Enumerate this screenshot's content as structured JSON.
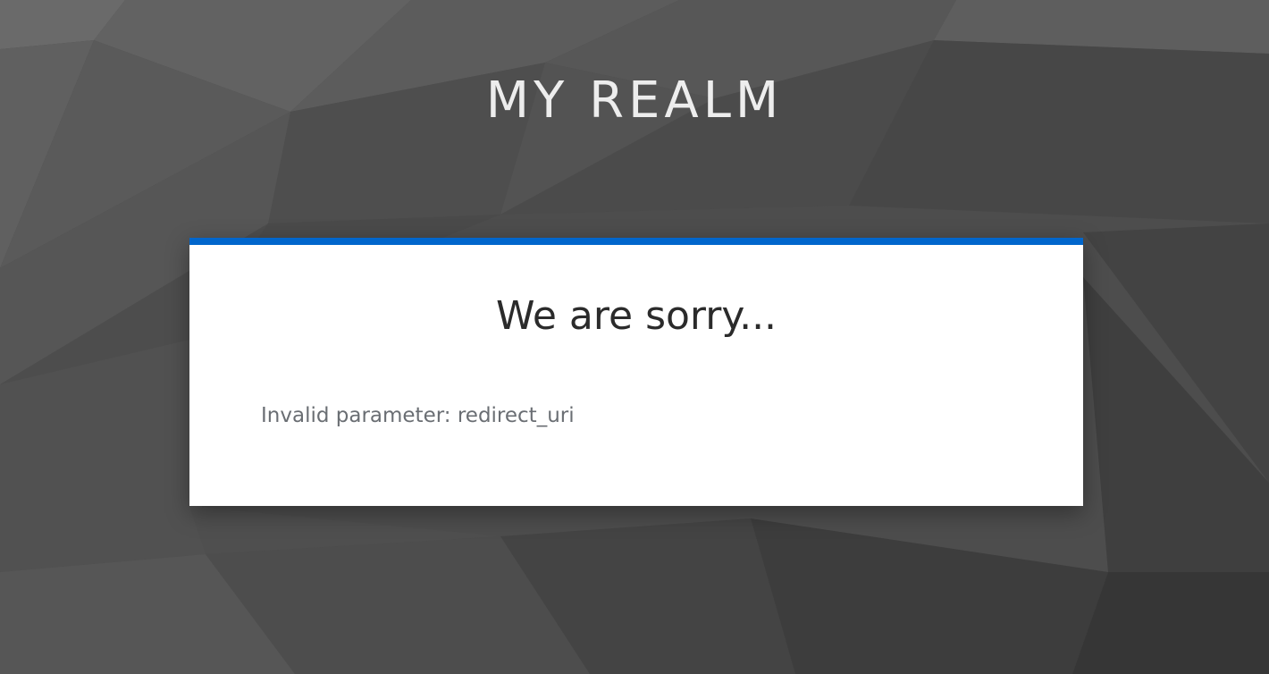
{
  "header": {
    "realm_name": "MY REALM"
  },
  "error_card": {
    "heading": "We are sorry...",
    "message": "Invalid parameter: redirect_uri"
  },
  "colors": {
    "background": "#4a4a4a",
    "accent": "#0066cc",
    "card": "#ffffff",
    "heading_text": "#2b2b2b",
    "message_text": "#6a6e73"
  }
}
